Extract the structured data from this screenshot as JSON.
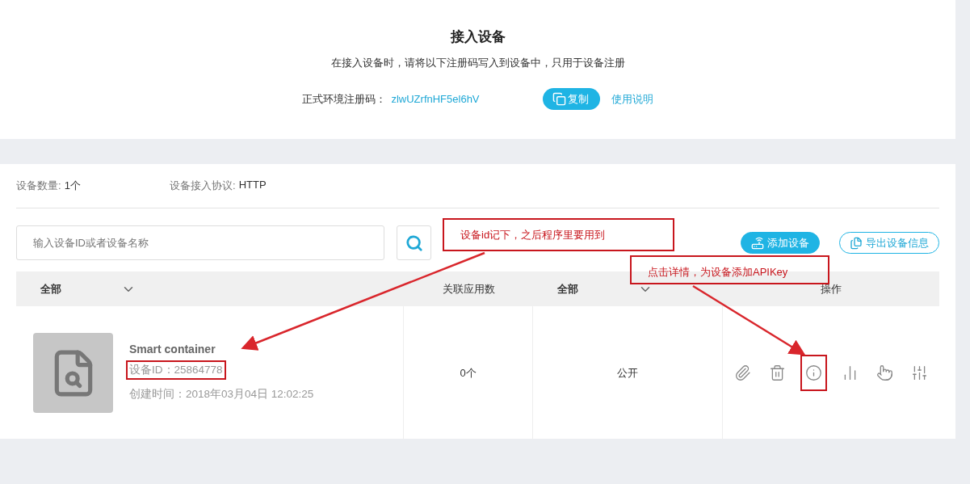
{
  "access": {
    "title": "接入设备",
    "subtitle": "在接入设备时，请将以下注册码写入到设备中，只用于设备注册",
    "code_label": "正式环境注册码：",
    "code": "zlwUZrfnHF5el6hV",
    "copy_button": "复制",
    "help_link": "使用说明"
  },
  "stats": [
    {
      "label": "设备数量:",
      "value": "1个"
    },
    {
      "label": "设备接入协议:",
      "value": "HTTP"
    }
  ],
  "search": {
    "placeholder": "输入设备ID或者设备名称"
  },
  "buttons": [
    {
      "label": "添加设备",
      "kind": "primary"
    },
    {
      "label": "导出设备信息",
      "kind": "outline"
    }
  ],
  "table": {
    "columns": [
      {
        "label": "全部",
        "kind": "filter"
      },
      {
        "label": "关联应用数",
        "kind": "plain"
      },
      {
        "label": "全部",
        "kind": "filter"
      },
      {
        "label": "操作",
        "kind": "plain"
      }
    ],
    "rows": [
      {
        "name": "Smart container",
        "id_text": "设备ID：25864778",
        "id_highlighted": true,
        "created": "创建时间：2018年03月04日 12:02:25",
        "apps": "0个",
        "visibility": "公开",
        "actions": [
          {
            "kind": "edit",
            "highlighted": false
          },
          {
            "kind": "delete",
            "highlighted": false
          },
          {
            "kind": "info",
            "highlighted": true
          },
          {
            "kind": "stats",
            "highlighted": false
          },
          {
            "kind": "trigger",
            "highlighted": false
          },
          {
            "kind": "settings",
            "highlighted": false
          }
        ]
      }
    ]
  },
  "annotations": [
    {
      "text": "设备id记下，之后程序里要用到"
    },
    {
      "text": "点击详情，为设备添加APIKey"
    }
  ]
}
